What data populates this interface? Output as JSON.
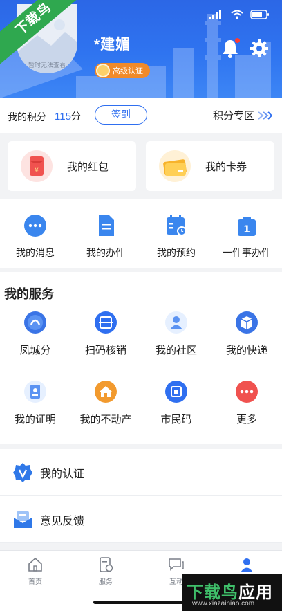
{
  "header": {
    "avatar_text": "暂时无法查看",
    "user_name": "*建媚",
    "cert_label": "高级认证"
  },
  "points": {
    "label": "我的积分",
    "value": "115",
    "unit": "分",
    "signin": "签到",
    "zone": "积分专区"
  },
  "cards": [
    {
      "label": "我的红包",
      "icon": "red-envelope-icon"
    },
    {
      "label": "我的卡券",
      "icon": "coupon-icon"
    }
  ],
  "quick_actions": [
    {
      "label": "我的消息",
      "icon": "message-icon"
    },
    {
      "label": "我的办件",
      "icon": "document-icon"
    },
    {
      "label": "我的预约",
      "icon": "calendar-icon"
    },
    {
      "label": "一件事办件",
      "icon": "one-thing-icon"
    }
  ],
  "services": {
    "title": "我的服务",
    "items": [
      {
        "label": "凤城分",
        "icon": "fengcheng-score-icon"
      },
      {
        "label": "扫码核销",
        "icon": "scan-icon"
      },
      {
        "label": "我的社区",
        "icon": "community-icon"
      },
      {
        "label": "我的快递",
        "icon": "package-icon"
      },
      {
        "label": "我的证明",
        "icon": "certificate-icon"
      },
      {
        "label": "我的不动产",
        "icon": "house-icon"
      },
      {
        "label": "市民码",
        "icon": "citizen-code-icon"
      },
      {
        "label": "更多",
        "icon": "more-icon"
      }
    ]
  },
  "list": [
    {
      "label": "我的认证",
      "icon": "verified-icon"
    },
    {
      "label": "意见反馈",
      "icon": "feedback-icon"
    }
  ],
  "tabbar": [
    {
      "label": "首页",
      "icon": "home-icon"
    },
    {
      "label": "服务",
      "icon": "service-icon"
    },
    {
      "label": "互动",
      "icon": "chat-icon"
    },
    {
      "label": "",
      "icon": "profile-icon"
    }
  ],
  "watermark": {
    "top_left": "下载鸟",
    "brand_a": "下载鸟",
    "brand_b": "应用",
    "url": "www.xiazainiao.com"
  },
  "colors": {
    "primary": "#2f6ff0",
    "orange": "#f08a2a",
    "red": "#f0524f"
  }
}
